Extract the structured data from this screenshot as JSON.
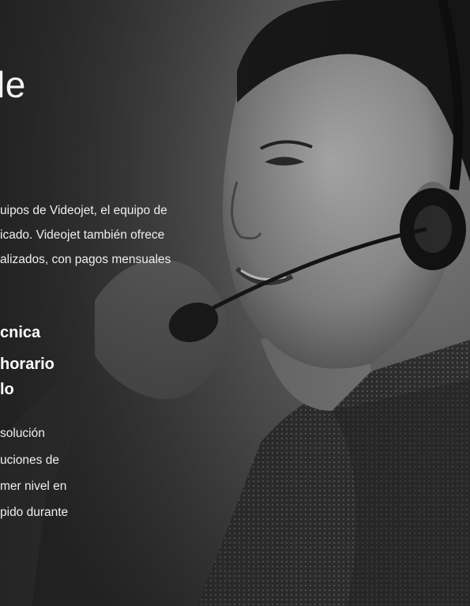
{
  "page": {
    "title_fragment": "le",
    "intro_lines": [
      "uipos de Videojet, el equipo de",
      "icado. Videojet también ofrece",
      "alizados, con pagos mensuales"
    ],
    "section_heading_lines": [
      "cnica",
      "horario",
      "lo"
    ],
    "section_body_lines": [
      "solución",
      "uciones de",
      "mer nivel en",
      "pido durante"
    ]
  },
  "image": {
    "subject": "support agent wearing headset, smiling",
    "style": "black and white photograph"
  }
}
